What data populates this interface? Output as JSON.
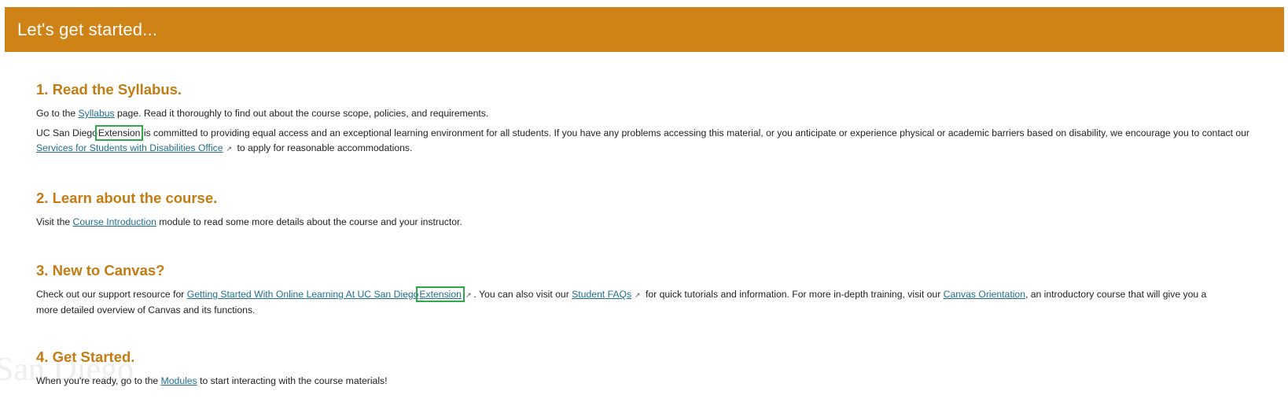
{
  "banner": {
    "title": "Let's get started..."
  },
  "sections": [
    {
      "heading": "1. Read the Syllabus.",
      "p1": {
        "before": "Go to the ",
        "link": "Syllabus",
        "after": " page. Read it thoroughly to find out about the course scope, policies, and requirements."
      },
      "p2": {
        "before": "UC San Diego",
        "highlight": "Extension",
        "middle": " is committed to providing equal access and an exceptional learning environment for all students. If you have any problems accessing this material, or you anticipate or experience physical or academic barriers based on disability, we encourage you to contact our ",
        "link": "Services for Students with Disabilities Office",
        "after": " to apply for reasonable accommodations."
      }
    },
    {
      "heading": "2. Learn about the course.",
      "p1": {
        "before": "Visit the ",
        "link": "Course Introduction",
        "after": " module to read some more details about the course and your instructor."
      }
    },
    {
      "heading": "3. New to Canvas?",
      "p1": {
        "before": "Check out our support resource for ",
        "link1": "Getting Started With Online Learning At UC San Diego",
        "link1_highlight": "Extension",
        "mid1": ". You can also visit our ",
        "link2": "Student FAQs",
        "mid2": " for quick tutorials and information. For more in-depth training, visit our ",
        "link3": "Canvas Orientation",
        "after": ", an introductory course that will give you a more detailed overview of Canvas and its functions."
      }
    },
    {
      "heading": "4. Get Started.",
      "p1": {
        "before": "When you're ready, go to the ",
        "link": "Modules",
        "after": " to start interacting with the course materials!"
      }
    }
  ],
  "watermark": "San Diego",
  "icons": {
    "external_link": "external-link-icon"
  },
  "colors": {
    "banner_bg": "#cf8215",
    "heading": "#c27c12",
    "link": "#1f6e8c",
    "highlight_box": "#2ca94a"
  }
}
